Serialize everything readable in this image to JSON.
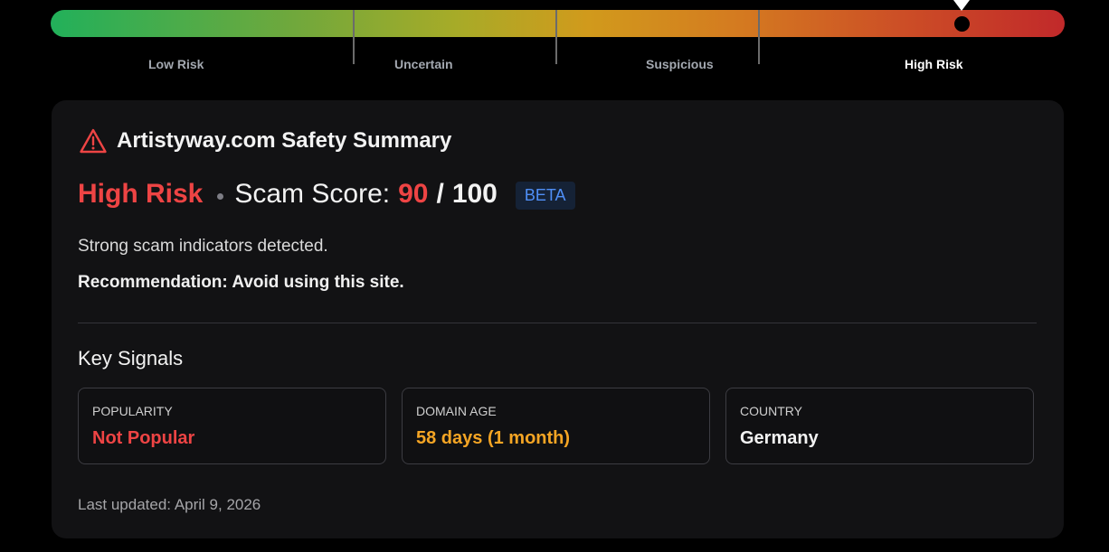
{
  "meter": {
    "levels": [
      "Low Risk",
      "Uncertain",
      "Suspicious",
      "High Risk"
    ],
    "active_level": "High Risk",
    "score": 90,
    "max": 100
  },
  "card": {
    "title": "Artistyway.com Safety Summary",
    "risk_level": "High Risk",
    "score_label": "Scam Score:",
    "score_value": "90",
    "score_separator": "/",
    "score_max": "100",
    "badge": "BETA",
    "summary": "Strong scam indicators detected.",
    "recommendation": "Recommendation: Avoid using this site.",
    "signals_title": "Key Signals",
    "signals": [
      {
        "label": "POPULARITY",
        "value": "Not Popular",
        "color": "#ee4444"
      },
      {
        "label": "DOMAIN AGE",
        "value": "58 days (1 month)",
        "color": "#f5a524"
      },
      {
        "label": "COUNTRY",
        "value": "Germany",
        "color": "#f2f2f2"
      }
    ],
    "last_updated": "Last updated: April 9, 2026"
  },
  "colors": {
    "danger": "#ee4444",
    "warning": "#f5a524",
    "beta": "#4f8ff7",
    "card_bg": "#121214"
  },
  "icons": {
    "title_icon": "warning-triangle-icon"
  }
}
